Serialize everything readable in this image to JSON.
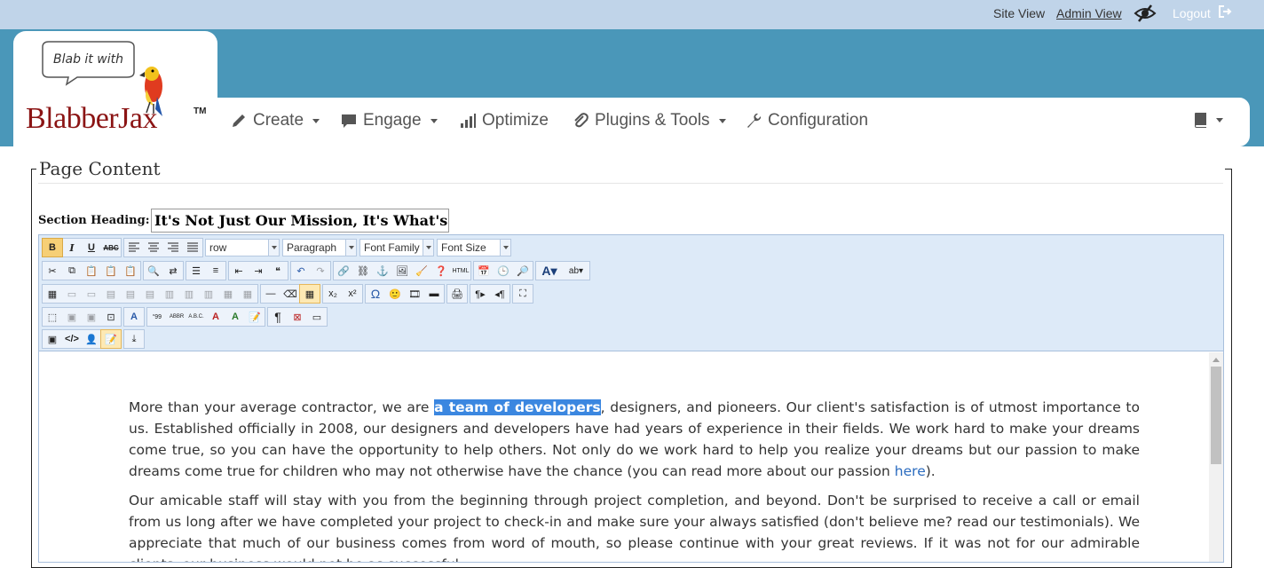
{
  "topbar": {
    "site_view": "Site View",
    "admin_view": "Admin View",
    "logout": "Logout"
  },
  "logo": {
    "bubble_text": "Blab it with",
    "brand": "BlabberJax",
    "tm": "TM"
  },
  "nav": {
    "create": "Create",
    "engage": "Engage",
    "optimize": "Optimize",
    "plugins": "Plugins & Tools",
    "configuration": "Configuration"
  },
  "content": {
    "legend": "Page Content",
    "section_heading_label": "Section Heading:",
    "section_heading_value": "It's Not Just Our Mission, It's What's in Our Hearts"
  },
  "toolbar": {
    "dropdowns": {
      "style": "row",
      "format": "Paragraph",
      "font_family": "Font Family",
      "font_size": "Font Size"
    },
    "bold": "B",
    "italic": "I",
    "underline": "U",
    "strike": "ABC"
  },
  "editor": {
    "p1_before": "More than your average contractor, we are ",
    "p1_highlight": "a team of developers",
    "p1_after": ", designers, and pioneers. Our client's satisfaction is of utmost importance to us. Established officially in 2008, our designers and developers have had years of experience in their fields. We work hard to make your dreams come true, so you can have the opportunity to help others.  Not only do we work hard to help you realize your dreams but our passion to make dreams come true for children who may not otherwise have the chance (you can read more about our passion ",
    "p1_link": "here",
    "p1_end": ").",
    "p2": "Our amicable staff will stay with you from the beginning through project completion, and beyond. Don't be surprised to receive a call or email from us  long after we have completed your project to check-in and make sure your always satisfied (don't believe me? read our testimonials). We appreciate that much of our business comes from word of mouth, so please continue with your great reviews. If it was not for our admirable clients, our business would not be as successful."
  },
  "colors": {
    "topbar_bg": "#c0d4e9",
    "header_bg": "#4a97b9",
    "brand": "#8b1414",
    "highlight": "#3b87e0",
    "toolbar_bg": "#ddeaf8"
  }
}
